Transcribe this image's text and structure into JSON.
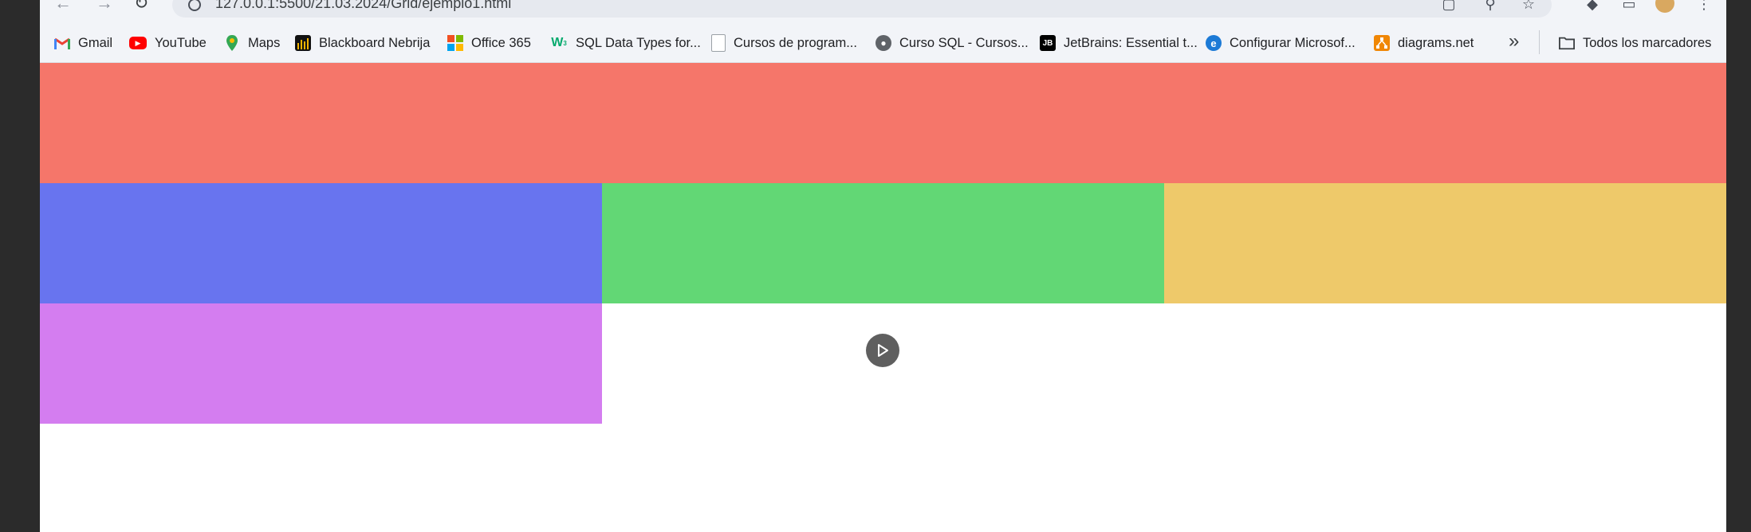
{
  "browser": {
    "url": "127.0.0.1:5500/21.03.2024/Grid/ejemplo1.html"
  },
  "bookmarks": [
    {
      "label": "Gmail",
      "icon": "gmail-icon"
    },
    {
      "label": "YouTube",
      "icon": "youtube-icon"
    },
    {
      "label": "Maps",
      "icon": "maps-icon"
    },
    {
      "label": "Blackboard Nebrija",
      "icon": "blackboard-icon"
    },
    {
      "label": "Office 365",
      "icon": "office-icon"
    },
    {
      "label": "SQL Data Types for...",
      "icon": "w3schools-icon"
    },
    {
      "label": "Cursos de program...",
      "icon": "page-icon"
    },
    {
      "label": "Curso SQL - Cursos...",
      "icon": "globe-icon"
    },
    {
      "label": "JetBrains: Essential t...",
      "icon": "jetbrains-icon"
    },
    {
      "label": "Configurar Microsof...",
      "icon": "ie-icon"
    },
    {
      "label": "diagrams.net",
      "icon": "drawio-icon"
    }
  ],
  "all_bookmarks_label": "Todos los marcadores",
  "grid_colors": {
    "header": "#f5766a",
    "cell1": "#6874ef",
    "cell2": "#62d775",
    "cell3": "#eec96a",
    "cell4": "#d47df0"
  }
}
